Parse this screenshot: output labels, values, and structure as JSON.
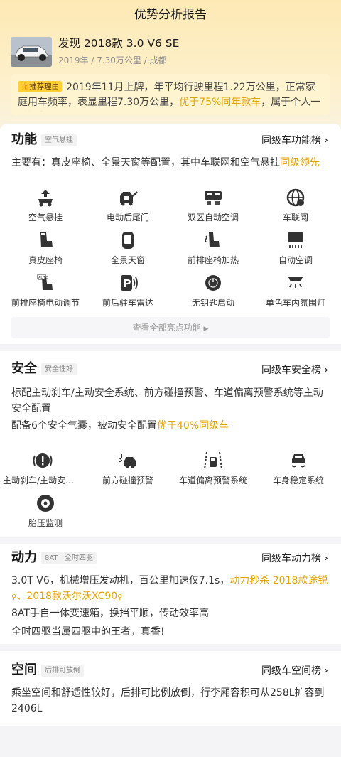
{
  "header": {
    "title": "优势分析报告"
  },
  "car": {
    "name": "发现 2018款 3.0 V6 SE",
    "meta": "2019年 / 7.30万公里 / 成都",
    "reason_badge": "推荐理由",
    "reason_text_a": "2019年11月上牌，年平均行驶里程1.22万公里，正常家庭用车频率，表显里程7.30万公里，",
    "reason_highlight": "优于75%同年款车",
    "reason_text_b": "，属于个人一手好车"
  },
  "function": {
    "title": "功能",
    "tag": "空气悬挂",
    "rank_link": "同级车功能榜",
    "desc_a": "主要有：真皮座椅、全景天窗等配置，其中车联网和空气悬挂",
    "desc_highlight": "同级领先",
    "features": [
      {
        "label": "空气悬挂",
        "icon": "air-suspension-icon"
      },
      {
        "label": "电动后尾门",
        "icon": "power-tailgate-icon"
      },
      {
        "label": "双区自动空调",
        "icon": "dual-zone-ac-icon"
      },
      {
        "label": "车联网",
        "icon": "connected-car-icon"
      },
      {
        "label": "真皮座椅",
        "icon": "leather-seat-icon"
      },
      {
        "label": "全景天窗",
        "icon": "panoramic-sunroof-icon"
      },
      {
        "label": "前排座椅加热",
        "icon": "seat-heating-icon"
      },
      {
        "label": "自动空调",
        "icon": "auto-ac-icon"
      },
      {
        "label": "前排座椅电动调节",
        "icon": "power-seat-icon"
      },
      {
        "label": "前后驻车雷达",
        "icon": "parking-radar-icon"
      },
      {
        "label": "无钥匙启动",
        "icon": "keyless-start-icon"
      },
      {
        "label": "单色车内氛围灯",
        "icon": "ambient-light-icon"
      }
    ],
    "more_label": "查看全部亮点功能"
  },
  "safety": {
    "title": "安全",
    "tag": "安全性好",
    "rank_link": "同级车安全榜",
    "desc1": "标配主动刹车/主动安全系统、前方碰撞预警、车道偏离预警系统等主动安全配置",
    "desc2_a": "配备6个安全气囊，被动安全配置",
    "desc2_highlight": "优于40%同级车",
    "features": [
      {
        "label": "主动刹车/主动安全系统",
        "icon": "active-brake-icon"
      },
      {
        "label": "前方碰撞预警",
        "icon": "collision-warning-icon"
      },
      {
        "label": "车道偏离预警系统",
        "icon": "lane-departure-icon"
      },
      {
        "label": "车身稳定系统",
        "icon": "stability-control-icon"
      },
      {
        "label": "胎压监测",
        "icon": "tire-pressure-icon"
      }
    ]
  },
  "power": {
    "title": "动力",
    "tag1": "8AT",
    "tag2": "全时四驱",
    "rank_link": "同级车动力榜",
    "line1_a": "3.0T V6，机械增压发动机，百公里加速仅7.1s，",
    "line1_highlight": "动力秒杀 2018款途锐",
    "line1_sep": "、",
    "line1_highlight2": "2018款沃尔沃XC90",
    "line2": "8AT手自一体变速箱，换挡平顺，传动效率高",
    "line3": "全时四驱当属四驱中的王者，真香!"
  },
  "space": {
    "title": "空间",
    "tag": "后排可放倒",
    "rank_link": "同级车空间榜",
    "desc": "乘坐空间和舒适性较好，后排可比例放倒，行李厢容积可从258L扩容到2406L"
  },
  "colors": {
    "accent": "#e7a300",
    "badge": "#ffcf33",
    "banner": "#fde9b4"
  }
}
